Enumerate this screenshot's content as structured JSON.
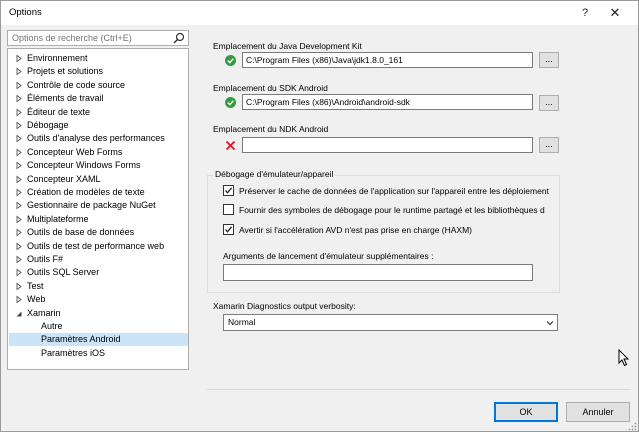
{
  "window": {
    "title": "Options",
    "help_label": "?",
    "close_label": "✕"
  },
  "search": {
    "placeholder": "Options de recherche (Ctrl+E)",
    "icon": "search-icon"
  },
  "tree": {
    "items": [
      {
        "label": "Environnement",
        "expandable": true,
        "expanded": false,
        "level": 0
      },
      {
        "label": "Projets et solutions",
        "expandable": true,
        "expanded": false,
        "level": 0
      },
      {
        "label": "Contrôle de code source",
        "expandable": true,
        "expanded": false,
        "level": 0
      },
      {
        "label": "Éléments de travail",
        "expandable": true,
        "expanded": false,
        "level": 0
      },
      {
        "label": "Éditeur de texte",
        "expandable": true,
        "expanded": false,
        "level": 0
      },
      {
        "label": "Débogage",
        "expandable": true,
        "expanded": false,
        "level": 0
      },
      {
        "label": "Outils d'analyse des performances",
        "expandable": true,
        "expanded": false,
        "level": 0
      },
      {
        "label": "Concepteur Web Forms",
        "expandable": true,
        "expanded": false,
        "level": 0
      },
      {
        "label": "Concepteur Windows Forms",
        "expandable": true,
        "expanded": false,
        "level": 0
      },
      {
        "label": "Concepteur XAML",
        "expandable": true,
        "expanded": false,
        "level": 0
      },
      {
        "label": "Création de modèles de texte",
        "expandable": true,
        "expanded": false,
        "level": 0
      },
      {
        "label": "Gestionnaire de package NuGet",
        "expandable": true,
        "expanded": false,
        "level": 0
      },
      {
        "label": "Multiplateforme",
        "expandable": true,
        "expanded": false,
        "level": 0
      },
      {
        "label": "Outils de base de données",
        "expandable": true,
        "expanded": false,
        "level": 0
      },
      {
        "label": "Outils de test de performance web",
        "expandable": true,
        "expanded": false,
        "level": 0
      },
      {
        "label": "Outils F#",
        "expandable": true,
        "expanded": false,
        "level": 0
      },
      {
        "label": "Outils SQL Server",
        "expandable": true,
        "expanded": false,
        "level": 0
      },
      {
        "label": "Test",
        "expandable": true,
        "expanded": false,
        "level": 0
      },
      {
        "label": "Web",
        "expandable": true,
        "expanded": false,
        "level": 0
      },
      {
        "label": "Xamarin",
        "expandable": true,
        "expanded": true,
        "level": 0
      },
      {
        "label": "Autre",
        "expandable": false,
        "expanded": false,
        "level": 1
      },
      {
        "label": "Paramètres Android",
        "expandable": false,
        "expanded": false,
        "level": 1,
        "selected": true
      },
      {
        "label": "Paramètres iOS",
        "expandable": false,
        "expanded": false,
        "level": 1
      }
    ]
  },
  "java_sdk": {
    "label": "Emplacement du Java Development Kit",
    "value": "C:\\Program Files (x86)\\Java\\jdk1.8.0_161",
    "status": "valid",
    "browse_label": "..."
  },
  "android_sdk": {
    "label": "Emplacement du SDK Android",
    "value": "C:\\Program Files (x86)\\Android\\android-sdk",
    "status": "valid",
    "browse_label": "..."
  },
  "android_ndk": {
    "label": "Emplacement du NDK Android",
    "value": "",
    "status": "invalid",
    "browse_label": "..."
  },
  "emulator": {
    "title": "Débogage d'émulateur/appareil",
    "options": [
      {
        "label": "Préserver le cache de données de l'application sur l'appareil entre les déploiement",
        "checked": true
      },
      {
        "label": "Fournir des symboles de débogage pour le runtime partagé et les bibliothèques d",
        "checked": false
      },
      {
        "label": "Avertir si l'accélération AVD n'est pas prise en charge (HAXM)",
        "checked": true
      }
    ],
    "args_label": "Arguments de lancement d'émulateur supplémentaires :",
    "args_value": ""
  },
  "diagnostics": {
    "label": "Xamarin Diagnostics output verbosity:",
    "selected": "Normal"
  },
  "buttons": {
    "ok": "OK",
    "cancel": "Annuler"
  },
  "colors": {
    "accent": "#0078d7",
    "selection": "#cce4f7",
    "valid": "#2e9e3f",
    "invalid": "#e81123"
  }
}
